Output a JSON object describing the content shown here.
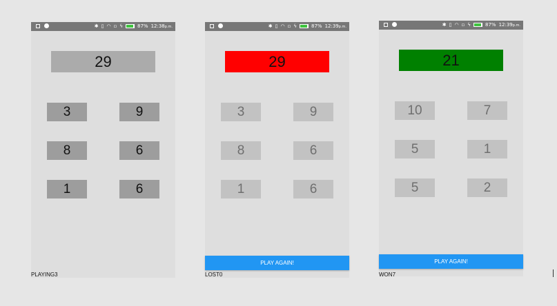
{
  "battery": {
    "percent_label": "87%",
    "fill": 0.87
  },
  "screens": [
    {
      "time": "12:38",
      "ampm": "p.m.",
      "target": "29",
      "numbers": [
        "3",
        "9",
        "8",
        "6",
        "1",
        "6"
      ],
      "status_prefix": "PLAYING",
      "status_value": "3",
      "state": "playing",
      "play_again": ""
    },
    {
      "time": "12:39",
      "ampm": "p.m.",
      "target": "29",
      "numbers": [
        "3",
        "9",
        "8",
        "6",
        "1",
        "6"
      ],
      "status_prefix": "LOST",
      "status_value": "0",
      "state": "lost",
      "play_again": "PLAY AGAIN!"
    },
    {
      "time": "12:39",
      "ampm": "p.m.",
      "target": "21",
      "numbers": [
        "10",
        "7",
        "5",
        "1",
        "5",
        "2"
      ],
      "status_prefix": "WON",
      "status_value": "7",
      "state": "won",
      "play_again": "PLAY AGAIN!"
    }
  ],
  "colors": {
    "target_playing": "#ababab",
    "target_lost": "#ff0000",
    "target_won": "#008000",
    "button_blue": "#2196f3"
  }
}
